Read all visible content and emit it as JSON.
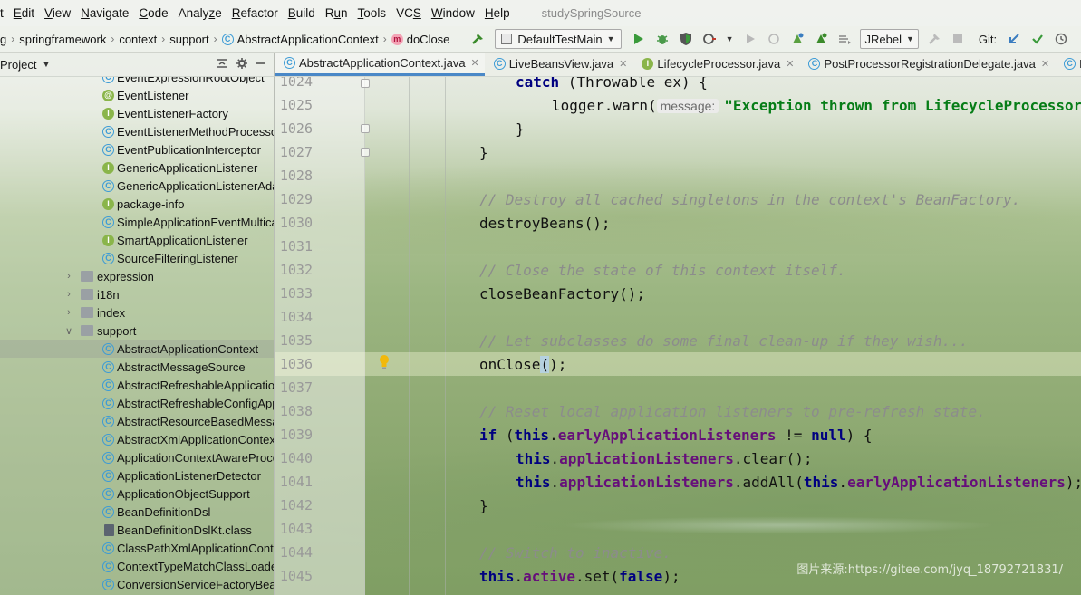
{
  "menubar": {
    "items": [
      "Edit",
      "View",
      "Navigate",
      "Code",
      "Analyze",
      "Refactor",
      "Build",
      "Run",
      "Tools",
      "VCS",
      "Window",
      "Help"
    ],
    "underline": [
      "E",
      "V",
      "N",
      "C",
      "z",
      "R",
      "B",
      "u",
      "T",
      "S",
      "W",
      "H"
    ],
    "leading_clip": "t",
    "project_title": "studySpringSource"
  },
  "breadcrumb": {
    "items": [
      "g",
      "springframework",
      "context",
      "support",
      "AbstractApplicationContext",
      "doClose"
    ]
  },
  "toolbar": {
    "run_config": "DefaultTestMain",
    "jrebel": "JRebel",
    "git_label": "Git:"
  },
  "project_panel": {
    "title": "Project"
  },
  "tabs": [
    {
      "label": "AbstractApplicationContext.java",
      "icon": "class",
      "active": true
    },
    {
      "label": "LiveBeansView.java",
      "icon": "class",
      "active": false
    },
    {
      "label": "LifecycleProcessor.java",
      "icon": "interface",
      "active": false
    },
    {
      "label": "PostProcessorRegistrationDelegate.java",
      "icon": "class",
      "active": false
    },
    {
      "label": "Lo",
      "icon": "class",
      "active": false
    }
  ],
  "tree": {
    "rows": [
      {
        "label": "EventExpressionRootObject",
        "icon": "class",
        "depth": 2
      },
      {
        "label": "EventListener",
        "icon": "annotation",
        "depth": 2
      },
      {
        "label": "EventListenerFactory",
        "icon": "interface",
        "depth": 2
      },
      {
        "label": "EventListenerMethodProcessor",
        "icon": "class",
        "depth": 2
      },
      {
        "label": "EventPublicationInterceptor",
        "icon": "class",
        "depth": 2
      },
      {
        "label": "GenericApplicationListener",
        "icon": "interface",
        "depth": 2
      },
      {
        "label": "GenericApplicationListenerAdapter",
        "icon": "class",
        "depth": 2
      },
      {
        "label": "package-info",
        "icon": "interface",
        "depth": 2
      },
      {
        "label": "SimpleApplicationEventMulticaster",
        "icon": "class",
        "depth": 2
      },
      {
        "label": "SmartApplicationListener",
        "icon": "interface",
        "depth": 2
      },
      {
        "label": "SourceFilteringListener",
        "icon": "class",
        "depth": 2
      },
      {
        "label": "expression",
        "icon": "package",
        "depth": 1,
        "arrow": "right"
      },
      {
        "label": "i18n",
        "icon": "package",
        "depth": 1,
        "arrow": "right"
      },
      {
        "label": "index",
        "icon": "package",
        "depth": 1,
        "arrow": "right"
      },
      {
        "label": "support",
        "icon": "package",
        "depth": 1,
        "arrow": "down"
      },
      {
        "label": "AbstractApplicationContext",
        "icon": "class",
        "depth": 2,
        "selected": true
      },
      {
        "label": "AbstractMessageSource",
        "icon": "class",
        "depth": 2
      },
      {
        "label": "AbstractRefreshableApplicationContext",
        "icon": "class",
        "depth": 2
      },
      {
        "label": "AbstractRefreshableConfigApplicationContext",
        "icon": "class",
        "depth": 2
      },
      {
        "label": "AbstractResourceBasedMessageSource",
        "icon": "class",
        "depth": 2
      },
      {
        "label": "AbstractXmlApplicationContext",
        "icon": "class",
        "depth": 2
      },
      {
        "label": "ApplicationContextAwareProcessor",
        "icon": "class",
        "depth": 2
      },
      {
        "label": "ApplicationListenerDetector",
        "icon": "class",
        "depth": 2
      },
      {
        "label": "ApplicationObjectSupport",
        "icon": "class",
        "depth": 2
      },
      {
        "label": "BeanDefinitionDsl",
        "icon": "class",
        "depth": 2
      },
      {
        "label": "BeanDefinitionDslKt.class",
        "icon": "file",
        "depth": 2
      },
      {
        "label": "ClassPathXmlApplicationContext",
        "icon": "class",
        "depth": 2
      },
      {
        "label": "ContextTypeMatchClassLoader",
        "icon": "class",
        "depth": 2
      },
      {
        "label": "ConversionServiceFactoryBean",
        "icon": "class",
        "depth": 2
      }
    ]
  },
  "editor": {
    "first_line": 1024,
    "current_line": 1036,
    "lines": [
      {
        "n": "1024",
        "indent": 1,
        "parts": [
          [
            "kw",
            "catch"
          ],
          [
            "t",
            " (Throwable ex) {"
          ]
        ]
      },
      {
        "n": "1025",
        "indent": 2,
        "parts": [
          [
            "t",
            "logger.warn("
          ],
          [
            "hint",
            "message:"
          ],
          [
            "str",
            "\"Exception thrown from LifecycleProcessor on context close\""
          ]
        ]
      },
      {
        "n": "1026",
        "indent": 1,
        "parts": [
          [
            "t",
            "}"
          ]
        ]
      },
      {
        "n": "1027",
        "indent": 0,
        "parts": [
          [
            "t",
            "}"
          ]
        ]
      },
      {
        "n": "1028",
        "indent": 0,
        "parts": []
      },
      {
        "n": "1029",
        "indent": 0,
        "parts": [
          [
            "cmt",
            "// Destroy all cached singletons in the context's BeanFactory."
          ]
        ]
      },
      {
        "n": "1030",
        "indent": 0,
        "parts": [
          [
            "t",
            "destroyBeans();"
          ]
        ]
      },
      {
        "n": "1031",
        "indent": 0,
        "parts": []
      },
      {
        "n": "1032",
        "indent": 0,
        "parts": [
          [
            "cmt",
            "// Close the state of this context itself."
          ]
        ]
      },
      {
        "n": "1033",
        "indent": 0,
        "parts": [
          [
            "t",
            "closeBeanFactory();"
          ]
        ]
      },
      {
        "n": "1034",
        "indent": 0,
        "parts": []
      },
      {
        "n": "1035",
        "indent": 0,
        "parts": [
          [
            "cmt",
            "// Let subclasses do some final clean-up if they wish..."
          ]
        ]
      },
      {
        "n": "1036",
        "indent": 0,
        "parts": [
          [
            "t",
            "onClose"
          ],
          [
            "bh",
            "("
          ],
          [
            "t",
            ");"
          ]
        ]
      },
      {
        "n": "1037",
        "indent": 0,
        "parts": []
      },
      {
        "n": "1038",
        "indent": 0,
        "parts": [
          [
            "cmt",
            "// Reset local application listeners to pre-refresh state."
          ]
        ]
      },
      {
        "n": "1039",
        "indent": 0,
        "parts": [
          [
            "kw",
            "if"
          ],
          [
            "t",
            " ("
          ],
          [
            "kw",
            "this"
          ],
          [
            "t",
            "."
          ],
          [
            "fld",
            "earlyApplicationListeners"
          ],
          [
            "t",
            " != "
          ],
          [
            "kw",
            "null"
          ],
          [
            "t",
            ") {"
          ]
        ]
      },
      {
        "n": "1040",
        "indent": 1,
        "parts": [
          [
            "kw",
            "this"
          ],
          [
            "t",
            "."
          ],
          [
            "fld",
            "applicationListeners"
          ],
          [
            "t",
            ".clear();"
          ]
        ]
      },
      {
        "n": "1041",
        "indent": 1,
        "parts": [
          [
            "kw",
            "this"
          ],
          [
            "t",
            "."
          ],
          [
            "fld",
            "applicationListeners"
          ],
          [
            "t",
            ".addAll("
          ],
          [
            "kw",
            "this"
          ],
          [
            "t",
            "."
          ],
          [
            "fld",
            "earlyApplicationListeners"
          ],
          [
            "t",
            ");"
          ]
        ]
      },
      {
        "n": "1042",
        "indent": 0,
        "parts": [
          [
            "t",
            "}"
          ]
        ]
      },
      {
        "n": "1043",
        "indent": 0,
        "parts": []
      },
      {
        "n": "1044",
        "indent": 0,
        "parts": [
          [
            "cmt",
            "// Switch to inactive."
          ]
        ]
      },
      {
        "n": "1045",
        "indent": 0,
        "parts": [
          [
            "kw",
            "this"
          ],
          [
            "t",
            "."
          ],
          [
            "fld",
            "active"
          ],
          [
            "t",
            ".set("
          ],
          [
            "kw",
            "false"
          ],
          [
            "t",
            ");"
          ]
        ]
      }
    ]
  },
  "watermark": "图片来源:https://gitee.com/jyq_18792721831/"
}
